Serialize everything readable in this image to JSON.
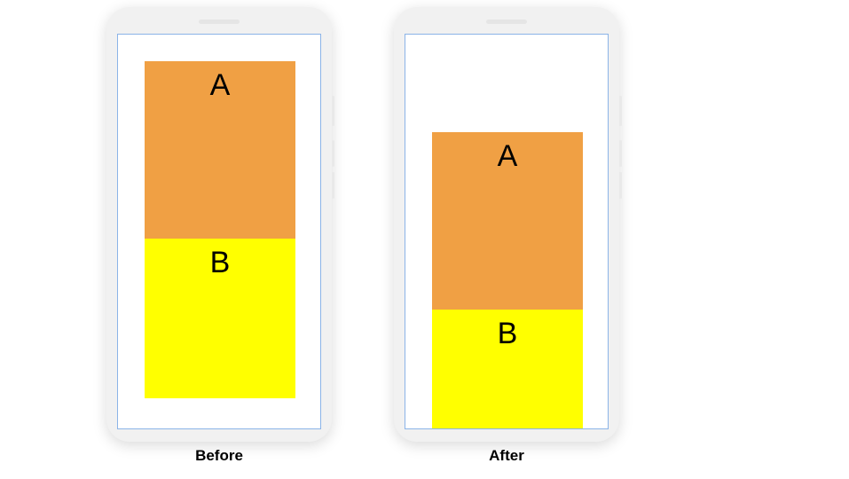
{
  "diagram": {
    "left": {
      "caption": "Before",
      "blocks": {
        "a": "A",
        "b": "B"
      }
    },
    "right": {
      "caption": "After",
      "blocks": {
        "a": "A",
        "b": "B"
      }
    }
  },
  "colors": {
    "block_a": "#f0a044",
    "block_b": "#ffff00",
    "screen_border": "#8bb4e8",
    "phone_body": "#f1f1f1"
  }
}
